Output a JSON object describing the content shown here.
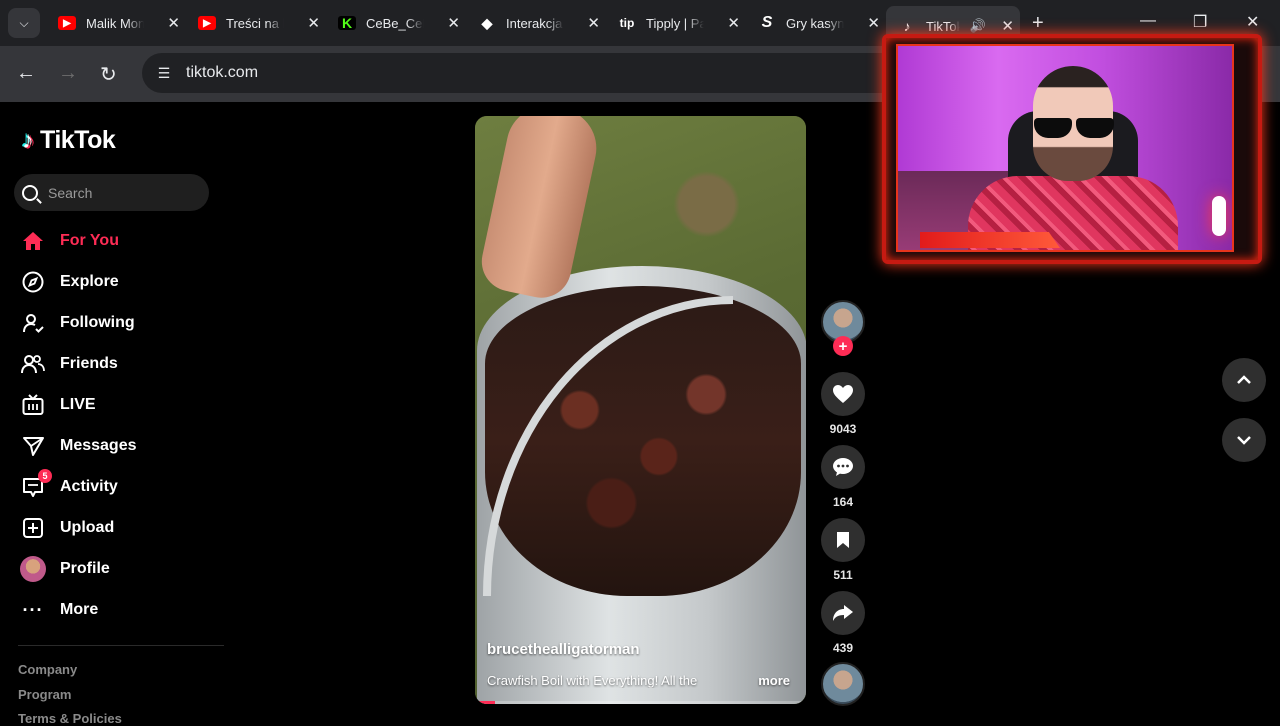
{
  "browser": {
    "tabs": [
      {
        "title": "Malik Montana",
        "favicon": "youtube-icon",
        "color": "#ff0000"
      },
      {
        "title": "Treści na kanale",
        "favicon": "youtube-studio-icon",
        "color": "#ff0000"
      },
      {
        "title": "CeBe_CeBe",
        "favicon": "kick-icon",
        "color": "#53fc18"
      },
      {
        "title": "Interakcja",
        "favicon": "streamelements-icon",
        "color": "#ffffff"
      },
      {
        "title": "Tipply | Panel",
        "favicon": "tipply-icon",
        "color": "#ffffff"
      },
      {
        "title": "Gry kasynowe",
        "favicon": "stake-icon",
        "color": "#ffffff"
      },
      {
        "title": "TikTok",
        "favicon": "tiktok-icon",
        "color": "#ffffff",
        "active": true
      }
    ],
    "url": "tiktok.com"
  },
  "sidebar": {
    "logo_text": "TikTok",
    "search_placeholder": "Search",
    "items": [
      {
        "label": "For You",
        "icon": "home-icon",
        "active": true
      },
      {
        "label": "Explore",
        "icon": "compass-icon"
      },
      {
        "label": "Following",
        "icon": "following-icon"
      },
      {
        "label": "Friends",
        "icon": "friends-icon"
      },
      {
        "label": "LIVE",
        "icon": "live-icon"
      },
      {
        "label": "Messages",
        "icon": "messages-icon"
      },
      {
        "label": "Activity",
        "icon": "activity-icon",
        "badge": "5"
      },
      {
        "label": "Upload",
        "icon": "upload-icon"
      },
      {
        "label": "Profile",
        "icon": "profile-avatar"
      },
      {
        "label": "More",
        "icon": "more-icon"
      }
    ],
    "footer_links": [
      "Company",
      "Program",
      "Terms & Policies"
    ]
  },
  "video": {
    "username": "brucethealligatorman",
    "description": "Crawfish Boil with Everything! All the",
    "more_label": "more",
    "progress": 0.06
  },
  "actions": {
    "likes": "9043",
    "comments": "164",
    "saves": "511",
    "shares": "439"
  },
  "colors": {
    "accent": "#fe2c55",
    "background": "#000000",
    "chrome_dark": "#202124",
    "chrome_light": "#35363a"
  }
}
